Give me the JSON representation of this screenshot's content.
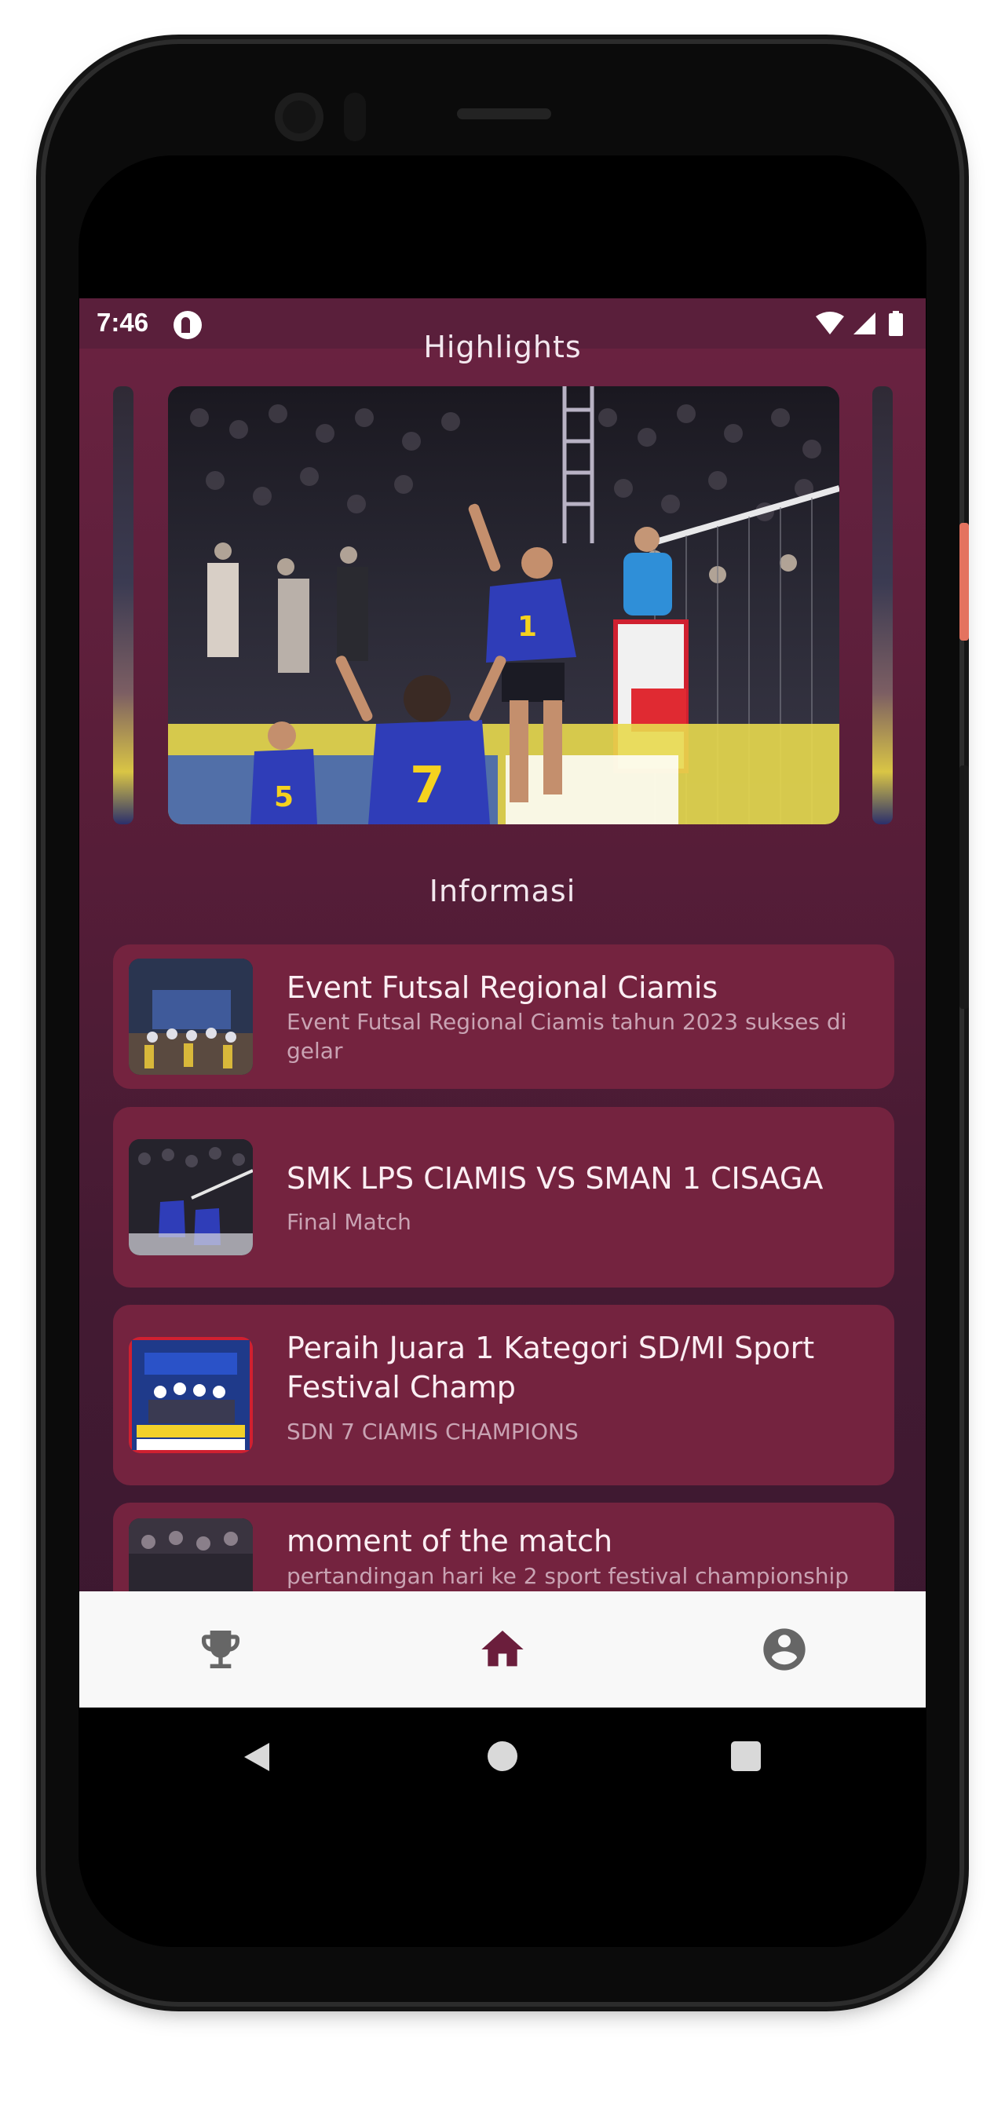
{
  "status_bar": {
    "time": "7:46"
  },
  "icons": {
    "status": [
      "app-notification-icon",
      "wifi-icon",
      "cellular-signal-icon",
      "battery-icon"
    ],
    "bottom_nav": [
      "trophy-icon",
      "home-icon",
      "account-icon"
    ],
    "system_nav": [
      "back-icon",
      "home-circle-icon",
      "recents-icon"
    ]
  },
  "highlights": {
    "title": "Highlights"
  },
  "informasi": {
    "title": "Informasi",
    "items": [
      {
        "title": "Event Futsal Regional Ciamis",
        "subtitle": "Event Futsal Regional Ciamis tahun 2023 sukses di gelar"
      },
      {
        "title": "SMK LPS CIAMIS VS SMAN 1 CISAGA",
        "subtitle": "Final Match"
      },
      {
        "title": "Peraih Juara 1 Kategori SD/MI Sport Festival Champ",
        "subtitle": "SDN 7 CIAMIS CHAMPIONS"
      },
      {
        "title": "moment of the match",
        "subtitle": "pertandingan hari ke 2 sport festival championship"
      }
    ]
  },
  "colors": {
    "background_top": "#6b2341",
    "background_bottom": "#3b1830",
    "card": "#74233f",
    "status_bar": "#5a1f3b",
    "nav_active": "#6b1e3c",
    "nav_inactive": "#666666",
    "nav_bar": "#f8f8f8"
  },
  "bottom_nav": {
    "active": "home"
  }
}
